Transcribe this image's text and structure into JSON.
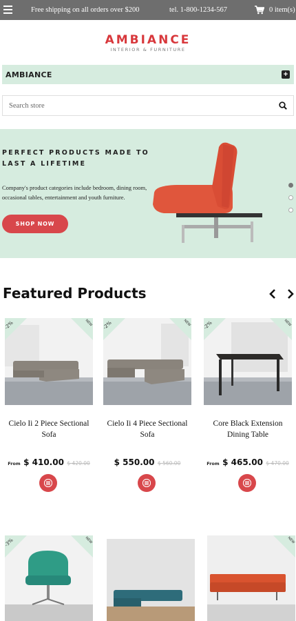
{
  "topbar": {
    "shipping_text": "Free shipping on all orders over $200",
    "phone": "tel. 1-800-1234-567",
    "cart_count": "0 item(s)"
  },
  "logo": {
    "title": "AMBIANCE",
    "subtitle": "INTERIOR & FURNITURE"
  },
  "category_bar": {
    "label": "AMBIANCE"
  },
  "search": {
    "placeholder": "Search store"
  },
  "hero": {
    "headline_line1": "PERFECT PRODUCTS MADE TO",
    "headline_line2": "LAST A LIFETIME",
    "description_line1": "Company's product categories include bedroom, dining room,",
    "description_line2": "occasional tables, entertainment and youth furniture.",
    "button_label": "SHOP NOW",
    "slide_count": 3,
    "active_slide": 1
  },
  "featured": {
    "title": "Featured Products",
    "products": [
      {
        "name_line1": "Cielo Ii 2 Piece Sectional",
        "name_line2": "Sofa",
        "discount": "-2%",
        "new_badge": "NEW",
        "from_label": "From",
        "price": "$ 410.00",
        "old_price": "$ 420.00"
      },
      {
        "name_line1": "Cielo Ii 4 Piece Sectional",
        "name_line2": "Sofa",
        "discount": "-2%",
        "new_badge": "NEW",
        "from_label": "",
        "price": "$ 550.00",
        "old_price": "$ 560.00"
      },
      {
        "name_line1": "Core Black Extension",
        "name_line2": "Dining Table",
        "discount": "-2%",
        "new_badge": "NEW",
        "from_label": "From",
        "price": "$ 465.00",
        "old_price": "$ 470.00"
      },
      {
        "discount": "-3%",
        "new_badge": "NEW"
      },
      {
        "new_badge": "NEW"
      },
      {
        "new_badge": "NEW"
      }
    ]
  },
  "colors": {
    "accent_red": "#d8474b",
    "logo_red": "#d8383c",
    "mint": "#d6ecdf",
    "topbar_gray": "#6e6e6e"
  },
  "icons": [
    "menu-icon",
    "cart-icon",
    "plus-icon",
    "search-icon",
    "arrow-left-icon",
    "arrow-right-icon",
    "hamburger-list-icon"
  ]
}
